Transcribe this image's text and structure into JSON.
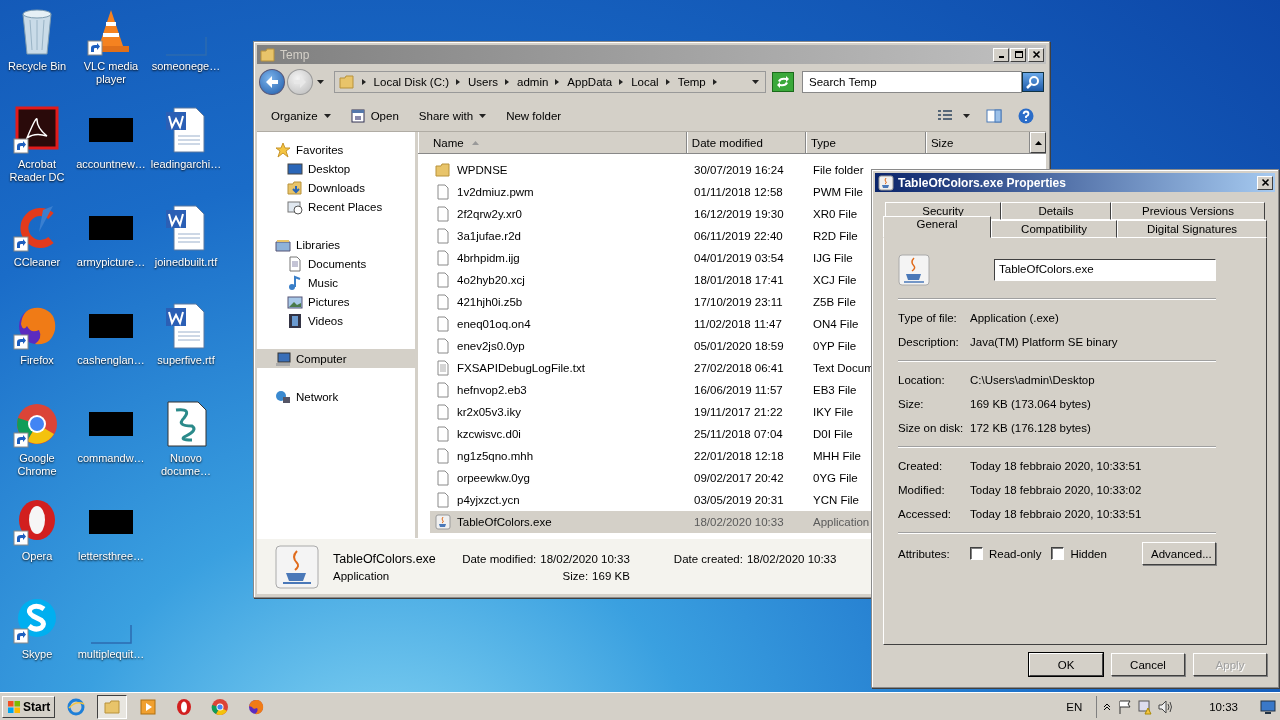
{
  "desktop_icons": [
    {
      "label": "Recycle Bin",
      "kind": "bin",
      "shortcut": false
    },
    {
      "label": "Acrobat Reader DC",
      "kind": "acrobat",
      "shortcut": true
    },
    {
      "label": "CCleaner",
      "kind": "ccleaner",
      "shortcut": true
    },
    {
      "label": "Firefox",
      "kind": "firefox",
      "shortcut": true
    },
    {
      "label": "Google Chrome",
      "kind": "chrome",
      "shortcut": true
    },
    {
      "label": "Opera",
      "kind": "opera",
      "shortcut": true
    },
    {
      "label": "Skype",
      "kind": "skype",
      "shortcut": true
    },
    {
      "label": "VLC media player",
      "kind": "vlc",
      "shortcut": true
    },
    {
      "label": "accountnew…",
      "kind": "dark",
      "shortcut": false
    },
    {
      "label": "armypicture…",
      "kind": "dark",
      "shortcut": false
    },
    {
      "label": "cashenglan…",
      "kind": "dark",
      "shortcut": false
    },
    {
      "label": "commandw…",
      "kind": "dark",
      "shortcut": false
    },
    {
      "label": "lettersthree…",
      "kind": "dark",
      "shortcut": false
    },
    {
      "label": "multiplequit…",
      "kind": "blank",
      "shortcut": false
    },
    {
      "label": "someonege…",
      "kind": "blank",
      "shortcut": false
    },
    {
      "label": "leadingarchi…",
      "kind": "word",
      "shortcut": false
    },
    {
      "label": "joinedbuilt.rtf",
      "kind": "word",
      "shortcut": false
    },
    {
      "label": "superfive.rtf",
      "kind": "word",
      "shortcut": false
    },
    {
      "label": "Nuovo docume…",
      "kind": "script",
      "shortcut": false
    }
  ],
  "explorer": {
    "title": "Temp",
    "breadcrumbs": [
      "Local Disk (C:)",
      "Users",
      "admin",
      "AppData",
      "Local",
      "Temp"
    ],
    "search": {
      "placeholder": "Search Temp"
    },
    "toolbar": [
      {
        "label": "Organize",
        "kind": "menu"
      },
      {
        "label": "Open",
        "kind": "open"
      },
      {
        "label": "Share with",
        "kind": "menu"
      },
      {
        "label": "New folder",
        "kind": "plain"
      }
    ],
    "nav": [
      {
        "label": "Favorites",
        "kind": "star",
        "selected": false,
        "children": [
          {
            "label": "Desktop",
            "kind": "desktop",
            "selected": false
          },
          {
            "label": "Downloads",
            "kind": "downloads",
            "selected": false
          },
          {
            "label": "Recent Places",
            "kind": "recent",
            "selected": false
          }
        ]
      },
      {
        "label": "Libraries",
        "kind": "library",
        "selected": false,
        "children": [
          {
            "label": "Documents",
            "kind": "documents",
            "selected": false
          },
          {
            "label": "Music",
            "kind": "music",
            "selected": false
          },
          {
            "label": "Pictures",
            "kind": "pictures",
            "selected": false
          },
          {
            "label": "Videos",
            "kind": "videos",
            "selected": false
          }
        ]
      },
      {
        "label": "Computer",
        "kind": "computer",
        "selected": true
      },
      {
        "label": "Network",
        "kind": "network",
        "selected": false
      }
    ],
    "columns": [
      "Name",
      "Date modified",
      "Type",
      "Size"
    ],
    "rows": [
      {
        "kind": "folder",
        "name": "WPDNSE",
        "date": "30/07/2019 16:24",
        "type": "File folder",
        "selected": false
      },
      {
        "kind": "file",
        "name": "1v2dmiuz.pwm",
        "date": "01/11/2018 12:58",
        "type": "PWM File",
        "selected": false
      },
      {
        "kind": "file",
        "name": "2f2qrw2y.xr0",
        "date": "16/12/2019 19:30",
        "type": "XR0 File",
        "selected": false
      },
      {
        "kind": "file",
        "name": "3a1jufae.r2d",
        "date": "06/11/2019 22:40",
        "type": "R2D File",
        "selected": false
      },
      {
        "kind": "file",
        "name": "4brhpidm.ijg",
        "date": "04/01/2019 03:54",
        "type": "IJG File",
        "selected": false
      },
      {
        "kind": "file",
        "name": "4o2hyb20.xcj",
        "date": "18/01/2018 17:41",
        "type": "XCJ File",
        "selected": false
      },
      {
        "kind": "file",
        "name": "421hjh0i.z5b",
        "date": "17/10/2019 23:11",
        "type": "Z5B File",
        "selected": false
      },
      {
        "kind": "file",
        "name": "eneq01oq.on4",
        "date": "11/02/2018 11:47",
        "type": "ON4 File",
        "selected": false
      },
      {
        "kind": "file",
        "name": "enev2js0.0yp",
        "date": "05/01/2020 18:59",
        "type": "0YP File",
        "selected": false
      },
      {
        "kind": "text",
        "name": "FXSAPIDebugLogFile.txt",
        "date": "27/02/2018 06:41",
        "type": "Text Docum",
        "selected": false
      },
      {
        "kind": "file",
        "name": "hefnvop2.eb3",
        "date": "16/06/2019 11:57",
        "type": "EB3 File",
        "selected": false
      },
      {
        "kind": "file",
        "name": "kr2x05v3.iky",
        "date": "19/11/2017 21:22",
        "type": "IKY File",
        "selected": false
      },
      {
        "kind": "file",
        "name": "kzcwisvc.d0i",
        "date": "25/11/2018 07:04",
        "type": "D0I File",
        "selected": false
      },
      {
        "kind": "file",
        "name": "ng1z5qno.mhh",
        "date": "22/01/2018 12:18",
        "type": "MHH File",
        "selected": false
      },
      {
        "kind": "file",
        "name": "orpeewkw.0yg",
        "date": "09/02/2017 20:42",
        "type": "0YG File",
        "selected": false
      },
      {
        "kind": "file",
        "name": "p4yjxzct.ycn",
        "date": "03/05/2019 20:31",
        "type": "YCN File",
        "selected": false
      },
      {
        "kind": "java",
        "name": "TableOfColors.exe",
        "date": "18/02/2020 10:33",
        "type": "Application",
        "selected": true
      }
    ],
    "details": {
      "name": "TableOfColors.exe",
      "type": "Application",
      "fields": [
        {
          "label": "Date modified:",
          "value": "18/02/2020 10:33"
        },
        {
          "label": "Size:",
          "value": "169 KB"
        },
        {
          "label": "Date created:",
          "value": "18/02/2020 10:33"
        }
      ]
    }
  },
  "dialog": {
    "title": "TableOfColors.exe Properties",
    "tab_rows": [
      [
        {
          "label": "Security",
          "selected": false
        },
        {
          "label": "Details",
          "selected": false
        },
        {
          "label": "Previous Versions",
          "selected": false
        }
      ],
      [
        {
          "label": "General",
          "selected": true
        },
        {
          "label": "Compatibility",
          "selected": false
        },
        {
          "label": "Digital Signatures",
          "selected": false
        }
      ]
    ],
    "file_name": "TableOfColors.exe",
    "sections": [
      [
        {
          "label": "Type of file:",
          "value": "Application (.exe)"
        },
        {
          "label": "Description:",
          "value": "Java(TM) Platform SE binary"
        }
      ],
      [
        {
          "label": "Location:",
          "value": "C:\\Users\\admin\\Desktop"
        },
        {
          "label": "Size:",
          "value": "169 KB (173.064 bytes)"
        },
        {
          "label": "Size on disk:",
          "value": "172 KB (176.128 bytes)"
        }
      ],
      [
        {
          "label": "Created:",
          "value": "Today 18 febbraio 2020, 10:33:51"
        },
        {
          "label": "Modified:",
          "value": "Today 18 febbraio 2020, 10:33:02"
        },
        {
          "label": "Accessed:",
          "value": "Today 18 febbraio 2020, 10:33:51"
        }
      ]
    ],
    "attributes_label": "Attributes:",
    "attributes": [
      {
        "label": "Read-only",
        "checked": false
      },
      {
        "label": "Hidden",
        "checked": false
      }
    ],
    "advanced_button": "Advanced...",
    "buttons": [
      {
        "label": "OK",
        "disabled": false,
        "default": true
      },
      {
        "label": "Cancel",
        "disabled": false,
        "default": false
      },
      {
        "label": "Apply",
        "disabled": true,
        "default": false
      }
    ]
  },
  "taskbar": {
    "start": "Start",
    "apps": [
      {
        "kind": "ie",
        "selected": false
      },
      {
        "kind": "explorer",
        "selected": true
      },
      {
        "kind": "media",
        "selected": false
      },
      {
        "kind": "opera",
        "selected": false
      },
      {
        "kind": "chrome",
        "selected": false
      },
      {
        "kind": "firefox",
        "selected": false
      }
    ],
    "language": "EN",
    "clock": "10:33"
  }
}
